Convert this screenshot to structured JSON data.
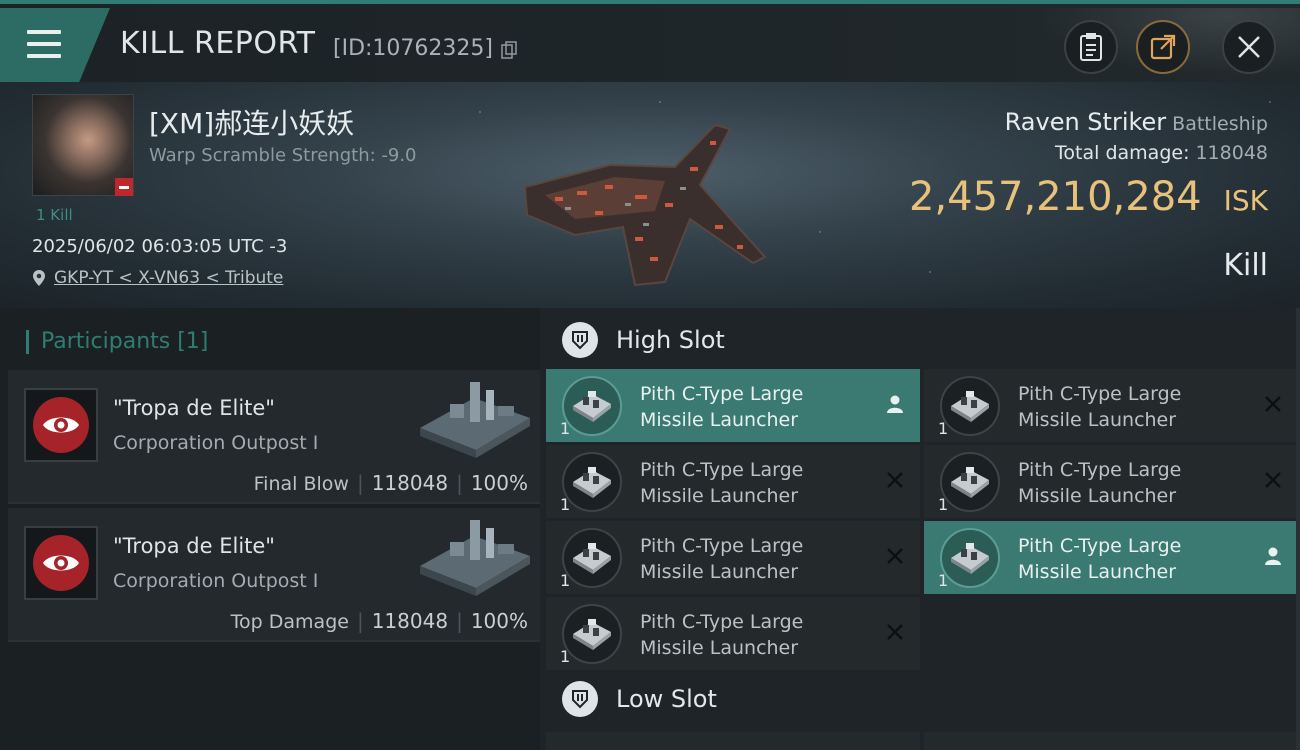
{
  "header": {
    "title": "KILL REPORT",
    "id_text": "[ID:10762325]"
  },
  "pilot": {
    "name": "[XM]郝连小妖妖",
    "warp_scramble": "Warp Scramble Strength: -9.0",
    "kills": "1 Kill",
    "time": "2025/06/02 06:03:05 UTC -3",
    "location": "GKP-YT < X-VN63 < Tribute"
  },
  "ship": {
    "name": "Raven Striker",
    "class": "Battleship",
    "total_damage_label": "Total damage:",
    "total_damage": "118048",
    "isk_value": "2,457,210,284",
    "isk_unit": "ISK",
    "result": "Kill"
  },
  "participants": {
    "heading": "Participants [1]",
    "items": [
      {
        "name": "\"Tropa de Elite\"",
        "corp": "Corporation Outpost I",
        "label": "Final Blow",
        "damage": "118048",
        "percent": "100%"
      },
      {
        "name": "\"Tropa de Elite\"",
        "corp": "Corporation Outpost I",
        "label": "Top Damage",
        "damage": "118048",
        "percent": "100%"
      }
    ]
  },
  "slots": {
    "high": {
      "title": "High Slot",
      "modules": [
        {
          "line1": "Pith C-Type Large",
          "line2": "Missile Launcher",
          "qty": "1",
          "state": "fitted"
        },
        {
          "line1": "Pith C-Type Large",
          "line2": "Missile Launcher",
          "qty": "1",
          "state": "destroyed"
        },
        {
          "line1": "Pith C-Type Large",
          "line2": "Missile Launcher",
          "qty": "1",
          "state": "destroyed"
        },
        {
          "line1": "Pith C-Type Large",
          "line2": "Missile Launcher",
          "qty": "1",
          "state": "destroyed"
        },
        {
          "line1": "Pith C-Type Large",
          "line2": "Missile Launcher",
          "qty": "1",
          "state": "destroyed"
        },
        {
          "line1": "Pith C-Type Large",
          "line2": "Missile Launcher",
          "qty": "1",
          "state": "fitted"
        },
        {
          "line1": "Pith C-Type Large",
          "line2": "Missile Launcher",
          "qty": "1",
          "state": "destroyed"
        }
      ]
    },
    "low": {
      "title": "Low Slot"
    }
  },
  "colors": {
    "accent": "#2f7d74",
    "isk": "#e8c27a",
    "threat": "#a52329"
  },
  "icons": [
    "menu-icon",
    "copy-icon",
    "clipboard-icon",
    "share-icon",
    "close-icon",
    "location-pin-icon",
    "eye-icon",
    "slot-icon",
    "person-icon"
  ]
}
